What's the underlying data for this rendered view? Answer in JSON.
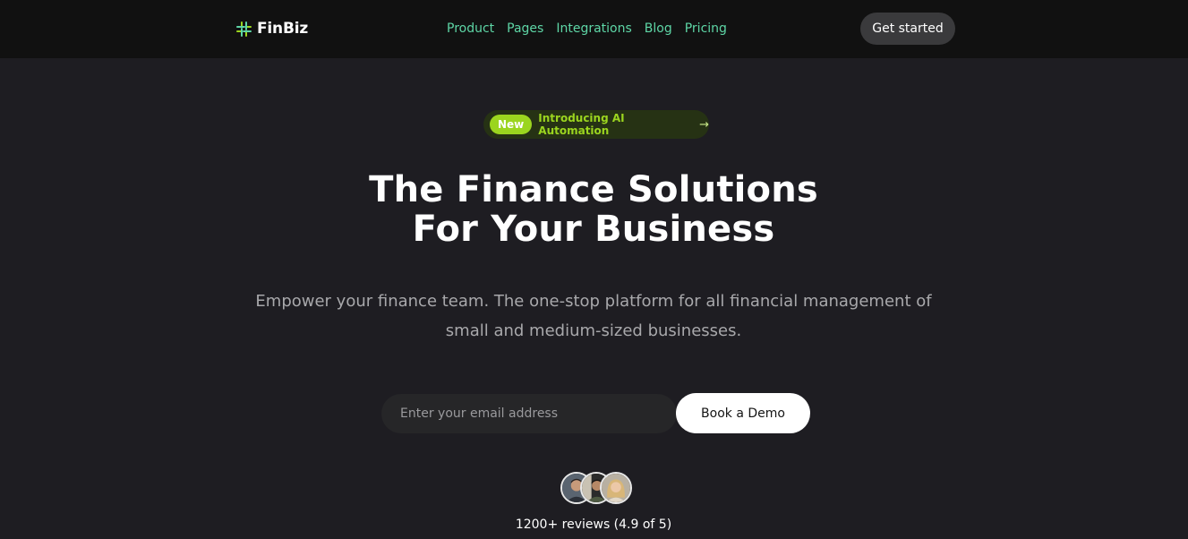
{
  "brand": {
    "name": "FinBiz",
    "icon": "logo-mark-icon",
    "accent_color": "#9bd51f"
  },
  "nav": {
    "items": [
      "Product",
      "Pages",
      "Integrations",
      "Blog",
      "Pricing"
    ],
    "link_color": "#5ed6a6"
  },
  "header": {
    "cta_label": "Get started"
  },
  "announcement": {
    "badge": "New",
    "text": "Introducing AI Automation",
    "icon": "arrow-right-icon"
  },
  "hero": {
    "headline_line1": "The Finance Solutions",
    "headline_line2": "For Your Business",
    "subtitle": "Empower your finance team. The one-stop platform for all financial management of small and medium-sized businesses."
  },
  "signup": {
    "email_placeholder": "Enter your email address",
    "email_value": "",
    "button_label": "Book a Demo"
  },
  "social_proof": {
    "avatars": [
      "avatar-man-icon",
      "avatar-person-icon",
      "avatar-woman-icon"
    ],
    "reviews_text": "1200+ reviews (4.9 of 5)"
  }
}
